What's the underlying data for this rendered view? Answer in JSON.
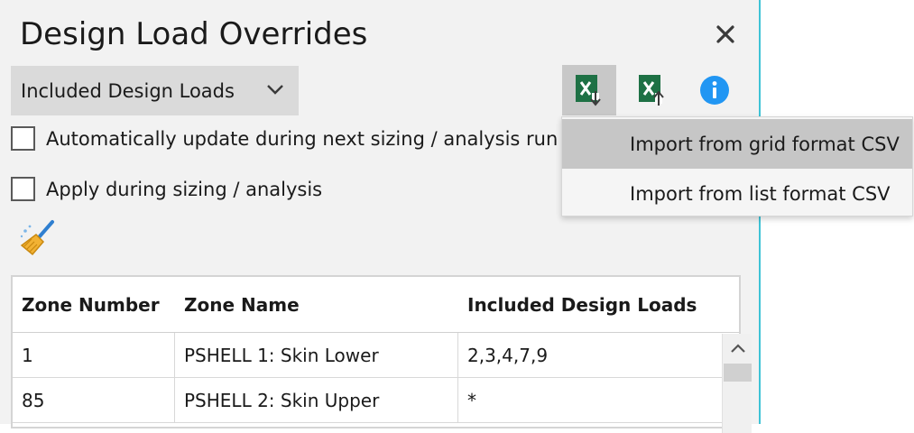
{
  "window": {
    "title": "Design Load Overrides"
  },
  "colors": {
    "panel_bg": "#f2f2f2",
    "accent_edge": "#3fc3d6",
    "excel_green": "#1e7145",
    "info_blue": "#2196f3"
  },
  "icons": {
    "close": "close-icon",
    "chevron": "chevron-down-icon",
    "import": "excel-import-icon",
    "export": "excel-export-icon",
    "info": "info-icon",
    "clear": "broom-icon",
    "scroll_up": "chevron-up-icon"
  },
  "dropdown": {
    "selected": "Included Design Loads"
  },
  "options": {
    "auto_update_label": "Automatically update during next sizing / analysis run",
    "apply_label": "Apply during sizing / analysis"
  },
  "grid": {
    "headers": [
      "Zone Number",
      "Zone Name",
      "Included Design Loads"
    ],
    "rows": [
      [
        "1",
        "PSHELL 1: Skin Lower",
        "2,3,4,7,9"
      ],
      [
        "85",
        "PSHELL 2: Skin Upper",
        "*"
      ]
    ]
  },
  "menu": {
    "items": [
      "Import from grid format CSV",
      "Import from list format CSV"
    ]
  }
}
